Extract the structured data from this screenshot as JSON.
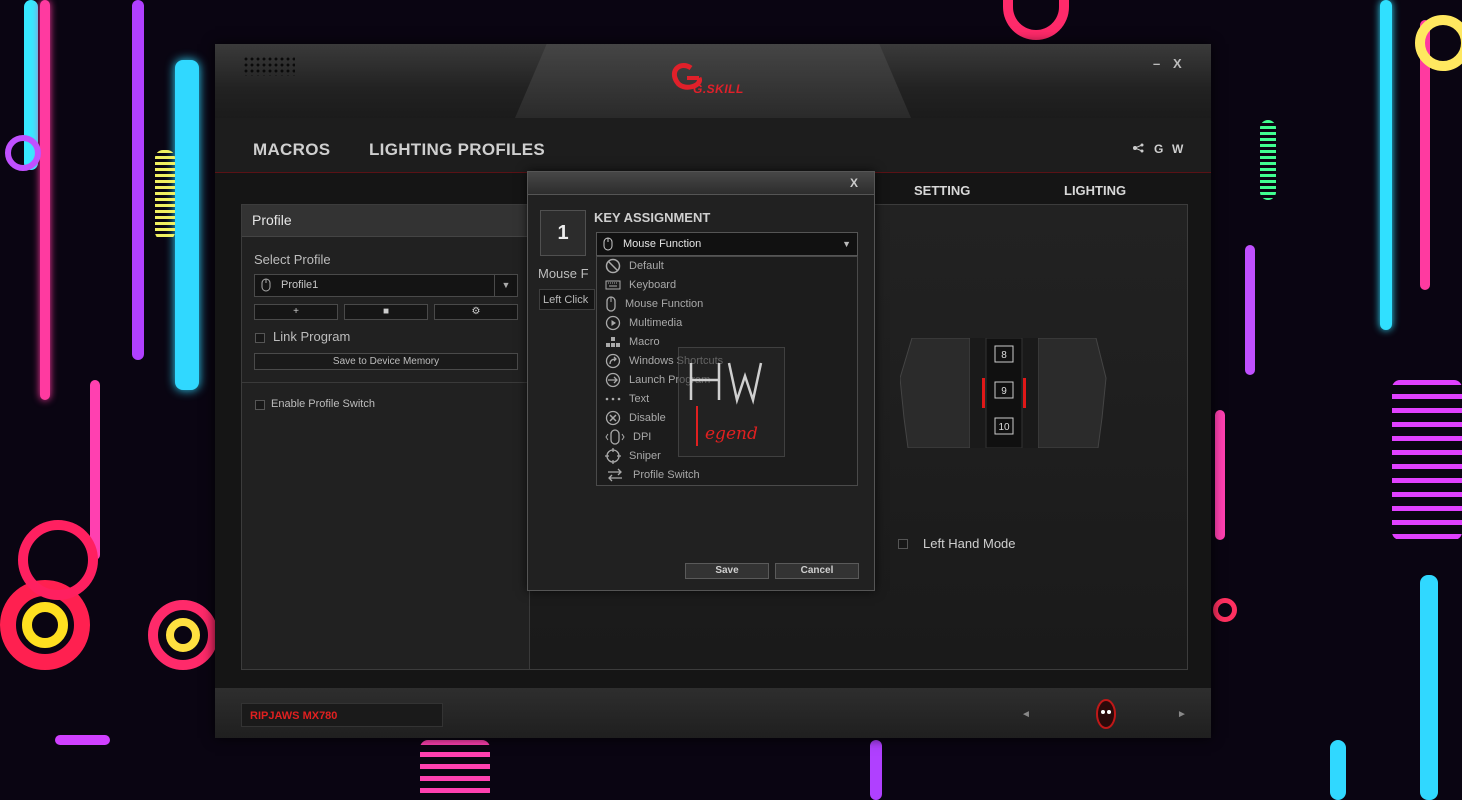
{
  "window": {
    "minimize_label": "–",
    "close_label": "X",
    "logo_text": "G.SKILL"
  },
  "nav": {
    "macros": "MACROS",
    "lighting_profiles": "LIGHTING PROFILES",
    "right_icons": [
      "share-icon"
    ],
    "g_label": "G",
    "w_label": "W"
  },
  "tabs": {
    "setting": "SETTING",
    "lighting": "LIGHTING"
  },
  "profile": {
    "header": "Profile",
    "select_label": "Select Profile",
    "selected": "Profile1",
    "add_label": "+",
    "delete_label": "■",
    "settings_label": "⚙",
    "link_program": "Link Program",
    "save_device": "Save to Device Memory",
    "enable_switch": "Enable Profile Switch"
  },
  "mouse_view": {
    "buttons": [
      "8",
      "9",
      "10"
    ],
    "left_hand": "Left  Hand Mode"
  },
  "dialog": {
    "close_label": "X",
    "key_number": "1",
    "title": "KEY ASSIGNMENT",
    "selected": "Mouse Function",
    "mouse_func_label": "Mouse F",
    "left_click": "Left Click",
    "options": [
      "Default",
      "Keyboard",
      "Mouse Function",
      "Multimedia",
      "Macro",
      "Windows Shortcuts",
      "Launch Program",
      "Text",
      "Disable",
      "DPI",
      "Sniper",
      "Profile Switch"
    ],
    "save": "Save",
    "cancel": "Cancel"
  },
  "footer": {
    "model": "RIPJAWS MX780",
    "prev": "◄",
    "next": "►"
  },
  "colors": {
    "accent": "#e0202a",
    "panel": "#212121"
  }
}
